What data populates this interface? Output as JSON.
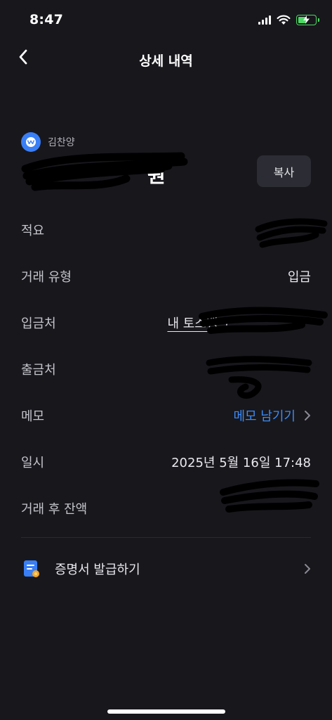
{
  "status_bar": {
    "time": "8:47",
    "icons": [
      "cellular-signal-icon",
      "wifi-icon",
      "battery-charging-icon"
    ],
    "battery_color": "#4cd964"
  },
  "nav": {
    "back_icon": "chevron-left-icon",
    "title": "상세 내역"
  },
  "header": {
    "counterparty_name": "김찬양",
    "bank_logo_color": "#3a7ff6",
    "amount_visible_suffix": "원",
    "copy_label": "복사"
  },
  "details": [
    {
      "label": "적요",
      "value": ""
    },
    {
      "label": "거래 유형",
      "value": "입금"
    },
    {
      "label": "입금처",
      "value": "내 토스뱅크"
    },
    {
      "label": "출금처",
      "value": ""
    },
    {
      "label": "메모",
      "value": "메모 남기기"
    },
    {
      "label": "일시",
      "value": "2025년 5월 16일 17:48"
    },
    {
      "label": "거래 후 잔액",
      "value": ""
    }
  ],
  "certificate": {
    "label": "증명서 발급하기",
    "icon": "document-certificate-icon"
  },
  "colors": {
    "background": "#18171c",
    "accent_link": "#3c8bf6",
    "button_bg": "#2c2c34"
  }
}
